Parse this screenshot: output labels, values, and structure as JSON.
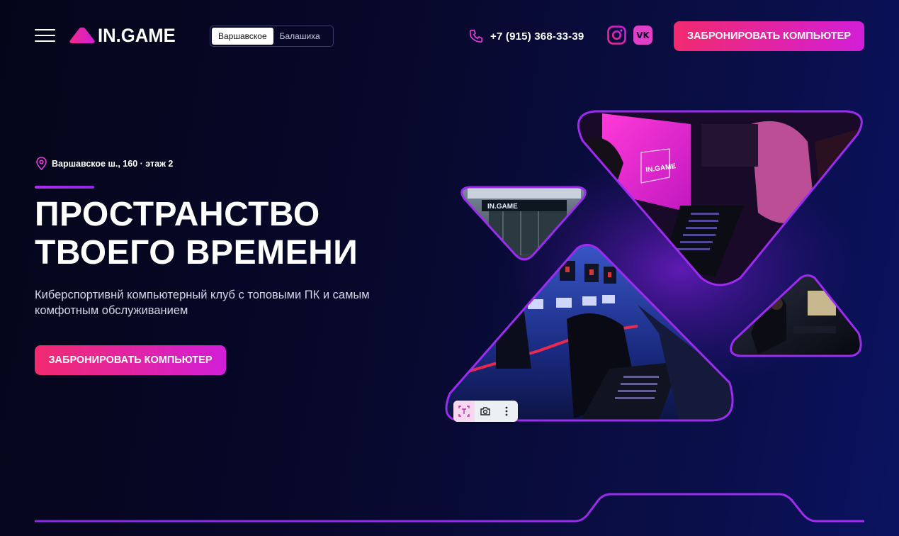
{
  "header": {
    "logo_text": "IN.GAME",
    "branches": [
      "Варшавское",
      "Балашиха"
    ],
    "active_branch": "Варшавское",
    "phone": "+7 (915) 368-33-39",
    "social": [
      {
        "icon": "instagram-icon"
      },
      {
        "icon": "vk-icon",
        "label": "VK"
      }
    ],
    "book_label": "ЗАБРОНИРОВАТЬ КОМПЬЮТЕР"
  },
  "hero": {
    "address": "Варшавское ш., 160 · этаж 2",
    "title_line1": "ПРОСТРАНСТВО",
    "title_line2": "ТВОЕГО ВРЕМЕНИ",
    "subtitle": "Киберспортивнй компьютерный клуб с топовыми ПК и самым комфотным обслуживанием",
    "book_label": "ЗАБРОНИРОВАТЬ КОМПЬЮТЕР"
  },
  "collage": {
    "sign_text": "IN.GAME",
    "screen_text": "IN.GAME"
  },
  "colors": {
    "accent_pink": "#f22a6f",
    "accent_magenta": "#d21ed8",
    "accent_purple": "#9b2cf0",
    "background": "#06071e"
  }
}
